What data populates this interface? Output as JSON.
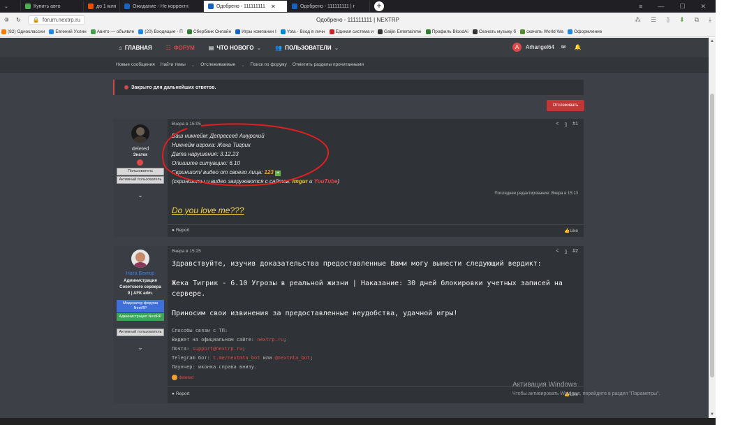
{
  "tabs": [
    {
      "label": "Купить авто",
      "color": "#4caf50"
    },
    {
      "label": "до 1 млн",
      "color": "#e65100"
    },
    {
      "label": "Ожидание - Не корректн",
      "color": "#1565c0"
    },
    {
      "label": "Одобрено - 111111111",
      "color": "#1565c0",
      "active": true
    },
    {
      "label": "Одобрено - 111111111 | г",
      "color": "#1565c0"
    }
  ],
  "browser": {
    "url": "forum.nextrp.ru",
    "page_title": "Одобрено - 111111111 | NEXTRP"
  },
  "bookmarks": [
    {
      "label": "(82) Одноклассни",
      "color": "#f57c00"
    },
    {
      "label": "Евгений Ухлин",
      "color": "#1e88e5"
    },
    {
      "label": "Авито — объявле",
      "color": "#43a047"
    },
    {
      "label": "(20) Входящие - П",
      "color": "#1e88e5"
    },
    {
      "label": "Сбербанк Онлайн",
      "color": "#2e7d32"
    },
    {
      "label": "Игры компании I",
      "color": "#1565c0"
    },
    {
      "label": "Yota - Вход в личн",
      "color": "#0288d1"
    },
    {
      "label": "Единая система и",
      "color": "#c62828"
    },
    {
      "label": "Gaijin Entertainme",
      "color": "#333333"
    },
    {
      "label": "Профиль BloodAi",
      "color": "#2e7d32"
    },
    {
      "label": "Скачать музыку б",
      "color": "#333333"
    },
    {
      "label": "скачать World Wa",
      "color": "#558b2f"
    },
    {
      "label": "Оформление",
      "color": "#1e88e5"
    }
  ],
  "nav": {
    "home": "ГЛАВНАЯ",
    "forums": "ФОРУМ",
    "whats_new": "ЧТО НОВОГО",
    "users": "ПОЛЬЗОВАТЕЛИ",
    "username": "Arhangel64",
    "avatar_letter": "A"
  },
  "subnav": [
    "Новые сообщения",
    "Найти темы",
    "Отслеживаемые",
    "Поиск по форуму",
    "Отметить разделы прочитанными"
  ],
  "thread": {
    "closed_notice": "Закрыто для дальнейших ответов.",
    "watch_button": "Отслеживать"
  },
  "post1": {
    "username": "deleted",
    "title": "Знаток",
    "badges": [
      "Пользователь",
      "Активный пользователь"
    ],
    "date": "Вчера в 15:05",
    "number": "#1",
    "lines": [
      "Ваш никнейм: Депрессед Амурский",
      "Никнейм игрока: Жека Тигрик",
      "Дата нарушения: 3.12.23",
      "Опишите ситуацию: 6.10",
      "Скриншот/ видео от своего лица:"
    ],
    "proof_link": "123",
    "hint_prefix": "(скриншоты и видео загружаются с сайтов:",
    "hint_imgur": "Imgur",
    "hint_and": "и",
    "hint_youtube": "YouTube",
    "hint_suffix": ")",
    "edited": "Последнее редактирование: Вчера в 15:13",
    "question": "Do you love me???",
    "report": "Report",
    "like": "Like"
  },
  "post2": {
    "username": "Ната Вектор",
    "title_lines": [
      "Администрация",
      "Советского сервера",
      "9 | AFK adm."
    ],
    "badges": [
      {
        "label": "Модератор форума NextRP",
        "color": "#3f6fd8"
      },
      {
        "label": "Администрация NextRP",
        "color": "#3aa655"
      },
      {
        "label": "Активный пользователь",
        "color": "#d8d8d8"
      }
    ],
    "date": "Вчера в 15:25",
    "number": "#2",
    "verdict_intro": "Здравствуйте, изучив доказательства предоставленные Вами могу вынести следующий вердикт:",
    "verdict_line1": "Жека Тигрик - 6.10 Угрозы в реальной жизни | Наказание: 30 дней блокировки учетных записей на",
    "verdict_line2": "сервере.",
    "apology": "Приносим свои извинения за предоставленные неудобства, удачной игры!",
    "contacts_title": "Способы связи с ТП:",
    "widget_label": "Виджет на официальном сайте:",
    "widget_link": "nextrp.ru",
    "mail_label": "Почта:",
    "mail_link": "support@nextrp.ru",
    "tg_label": "Telegram бот:",
    "tg_link1": "t.me/nextmta_bot",
    "tg_or": "или",
    "tg_link2": "@nextmta_bot",
    "launcher": "Лаунчер: иконка справа внизу.",
    "reaction_user": "deleted",
    "report": "Report",
    "like": "Like"
  },
  "windows": {
    "activation_title": "Активация Windows",
    "activation_text": "Чтобы активировать Windows, перейдите в раздел \"Параметры\"."
  }
}
